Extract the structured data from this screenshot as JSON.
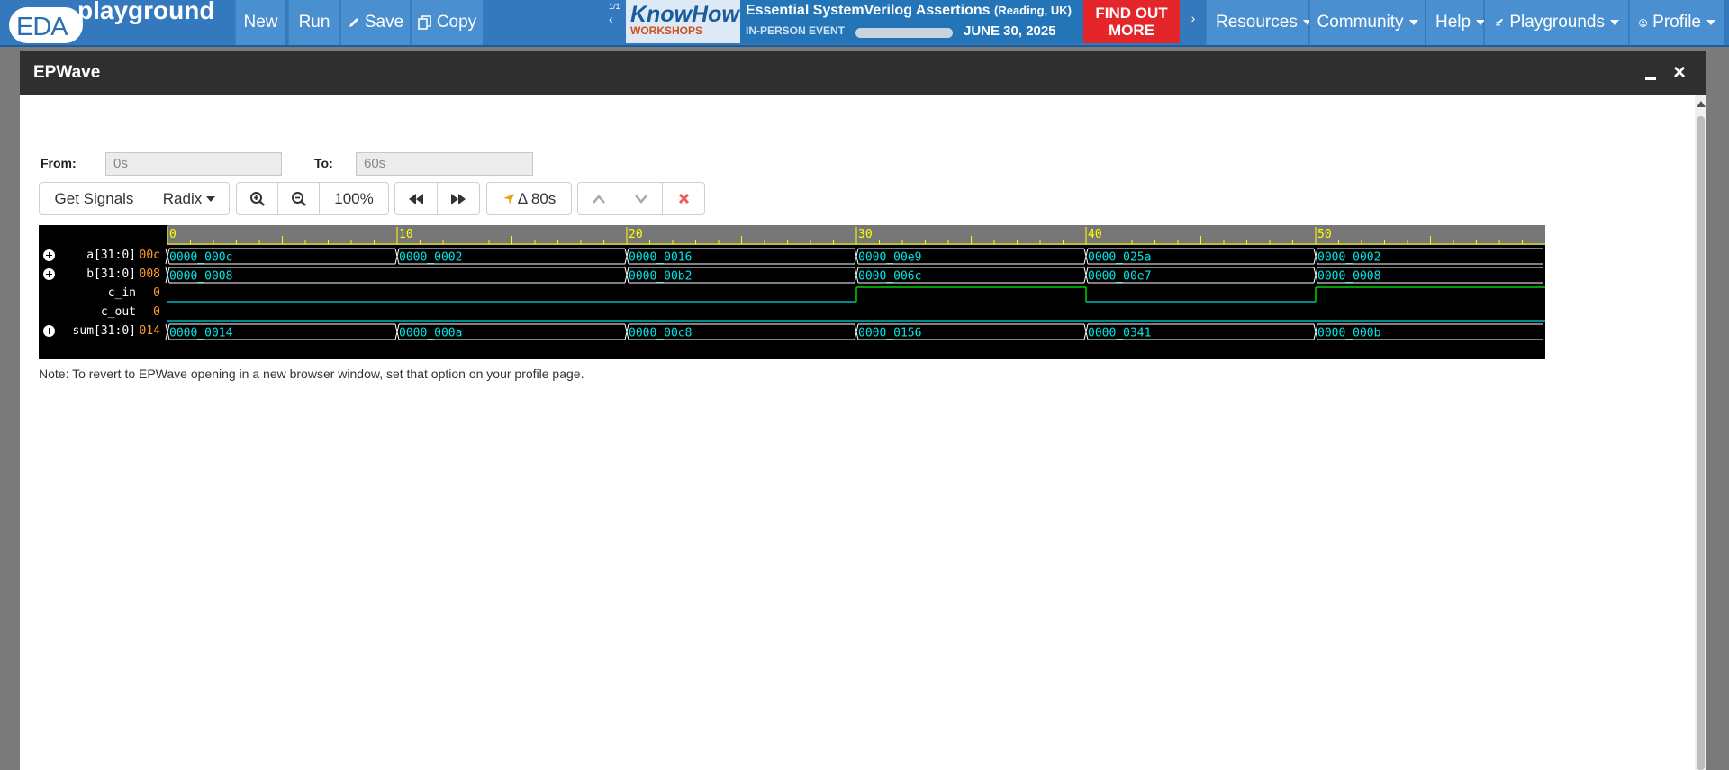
{
  "topnav": {
    "logo_eda": "EDA",
    "logo_playground": "playground",
    "buttons": {
      "new": "New",
      "run": "Run",
      "save": "Save",
      "copy": "Copy"
    },
    "ad": {
      "counter": "1/1",
      "brand_1": "KnowHow",
      "brand_2": "WORKSHOPS",
      "headline": "Essential SystemVerilog Assertions",
      "location": "(Reading, UK)",
      "event_type": "IN-PERSON EVENT",
      "date": "JUNE 30, 2025",
      "cta_line1": "FIND OUT",
      "cta_line2": "MORE"
    },
    "menus": {
      "resources": "Resources",
      "community": "Community",
      "help": "Help",
      "playgrounds": "Playgrounds",
      "profile": "Profile"
    },
    "colors": {
      "bar": "#3479bd",
      "button": "#4a8fd0",
      "ad_cta": "#e4262b"
    }
  },
  "modal": {
    "title": "EPWave",
    "from_label": "From:",
    "from_value": "0s",
    "to_label": "To:",
    "to_value": "60s",
    "toolbar": {
      "get_signals": "Get Signals",
      "radix": "Radix",
      "zoom_in_icon": "zoom-in-icon",
      "zoom_out_icon": "zoom-out-icon",
      "zoom_level": "100%",
      "rewind_icon": "fast-backward-icon",
      "forward_icon": "fast-forward-icon",
      "delta": "Δ 80s",
      "up_icon": "chevron-up-icon",
      "down_icon": "chevron-down-icon",
      "delete_icon": "delete-icon"
    },
    "note": "Note: To revert to EPWave opening in a new browser window, set that option on your profile page."
  },
  "waveform": {
    "time_range": [
      0,
      60
    ],
    "ruler_labels": [
      "0",
      "10",
      "20",
      "30",
      "40",
      "50"
    ],
    "ruler_values": [
      0,
      10,
      20,
      30,
      40,
      50
    ],
    "signals": [
      {
        "name": "a[31:0]",
        "cursor_value": "00c",
        "expandable": true,
        "kind": "bus",
        "segments": [
          {
            "t": 0,
            "label": "0000_000c"
          },
          {
            "t": 10,
            "label": "0000_0002"
          },
          {
            "t": 20,
            "label": "0000_0016"
          },
          {
            "t": 30,
            "label": "0000_00e9"
          },
          {
            "t": 40,
            "label": "0000_025a"
          },
          {
            "t": 50,
            "label": "0000_0002"
          }
        ]
      },
      {
        "name": "b[31:0]",
        "cursor_value": "008",
        "expandable": true,
        "kind": "bus",
        "segments": [
          {
            "t": 0,
            "label": "0000_0008"
          },
          {
            "t": 20,
            "label": "0000_00b2"
          },
          {
            "t": 30,
            "label": "0000_006c"
          },
          {
            "t": 40,
            "label": "0000_00e7"
          },
          {
            "t": 50,
            "label": "0000_0008"
          }
        ]
      },
      {
        "name": "c_in",
        "cursor_value": "0",
        "expandable": false,
        "kind": "bit",
        "levels": [
          {
            "t": 0,
            "v": 0
          },
          {
            "t": 30,
            "v": 1
          },
          {
            "t": 40,
            "v": 0
          },
          {
            "t": 50,
            "v": 1
          }
        ]
      },
      {
        "name": "c_out",
        "cursor_value": "0",
        "expandable": false,
        "kind": "bit",
        "levels": [
          {
            "t": 0,
            "v": 0
          }
        ]
      },
      {
        "name": "sum[31:0]",
        "cursor_value": "014",
        "expandable": true,
        "kind": "bus",
        "segments": [
          {
            "t": 0,
            "label": "0000_0014"
          },
          {
            "t": 10,
            "label": "0000_000a"
          },
          {
            "t": 20,
            "label": "0000_00c8"
          },
          {
            "t": 30,
            "label": "0000_0156"
          },
          {
            "t": 40,
            "label": "0000_0341"
          },
          {
            "t": 50,
            "label": "0000_000b"
          }
        ]
      }
    ],
    "colors": {
      "background": "#000000",
      "bus": "#ffffff",
      "label": "#00e5e5",
      "bit_low": "#00b8b8",
      "bit_high": "#00d000",
      "ruler": "#777777",
      "ruler_text": "#ffff00",
      "cursor_value": "#ff9c2e"
    }
  }
}
